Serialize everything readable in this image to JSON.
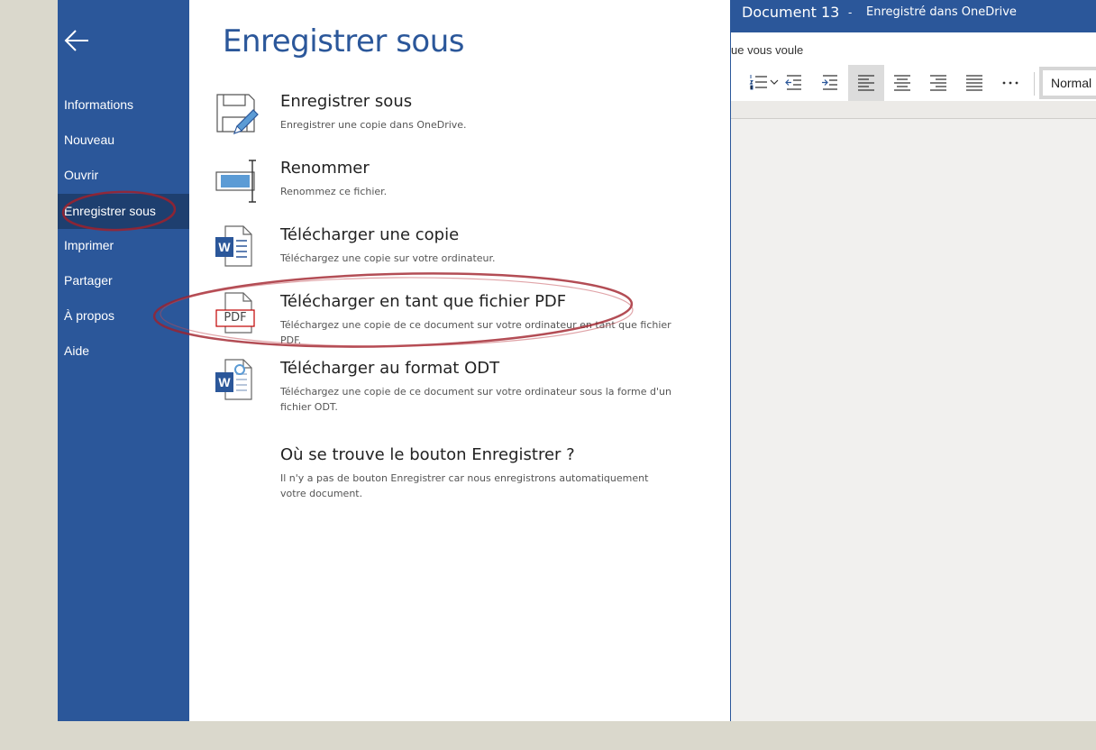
{
  "nav": {
    "items": [
      {
        "label": "Informations",
        "active": false
      },
      {
        "label": "Nouveau",
        "active": false
      },
      {
        "label": "Ouvrir",
        "active": false
      },
      {
        "label": "Enregistrer sous",
        "active": true
      },
      {
        "label": "Imprimer",
        "active": false
      },
      {
        "label": "Partager",
        "active": false
      },
      {
        "label": "À propos",
        "active": false
      },
      {
        "label": "Aide",
        "active": false
      }
    ]
  },
  "panel": {
    "title": "Enregistrer sous",
    "options": [
      {
        "title": "Enregistrer sous",
        "desc": "Enregistrer une copie dans OneDrive.",
        "icon": "save-as-icon"
      },
      {
        "title": "Renommer",
        "desc": "Renommez ce fichier.",
        "icon": "rename-icon"
      },
      {
        "title": "Télécharger une copie",
        "desc": "Téléchargez une copie sur votre ordinateur.",
        "icon": "word-document-icon"
      },
      {
        "title": "Télécharger en tant que fichier PDF",
        "desc": "Téléchargez une copie de ce document sur votre ordinateur en tant que fichier PDF.",
        "icon": "pdf-icon",
        "icon_text": "PDF"
      },
      {
        "title": "Télécharger au format ODT",
        "desc": "Téléchargez une copie de ce document sur votre ordinateur sous la forme d'un fichier ODT.",
        "icon": "odt-icon"
      },
      {
        "title": "Où se trouve le bouton Enregistrer ?",
        "desc": "Il n'y a pas de bouton Enregistrer car nous enregistrons automatiquement votre document."
      }
    ]
  },
  "document": {
    "name": "Document 13",
    "separator": "-",
    "status": "Enregistré dans OneDrive",
    "ribbon_text": "ue vous voule",
    "style_value": "Normal",
    "ribbon_buttons": [
      "numbered-list-icon",
      "decrease-indent-icon",
      "increase-indent-icon",
      "align-left-icon",
      "align-center-icon",
      "align-right-icon",
      "justify-icon",
      "more-icon"
    ]
  },
  "colors": {
    "accent": "#2b579a",
    "nav_active": "#1e3f6f",
    "annotation": "#a0212b"
  }
}
